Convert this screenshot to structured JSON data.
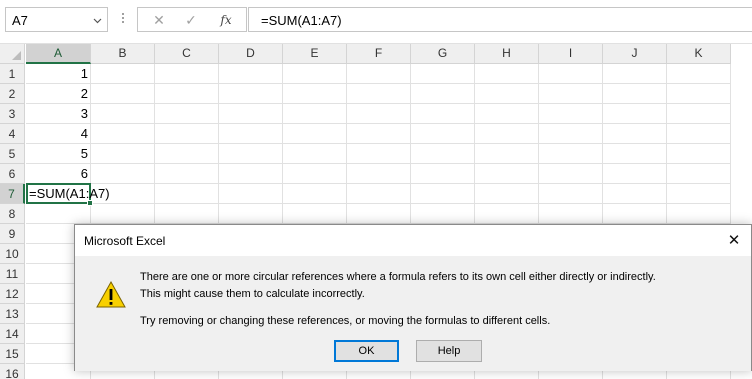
{
  "formula_bar": {
    "name_box": "A7",
    "cancel_symbol": "✕",
    "enter_symbol": "✓",
    "function_symbol": "fx",
    "formula": "=SUM(A1:A7)"
  },
  "columns": [
    "A",
    "B",
    "C",
    "D",
    "E",
    "F",
    "G",
    "H",
    "I",
    "J",
    "K"
  ],
  "rows": [
    "1",
    "2",
    "3",
    "4",
    "5",
    "6",
    "7",
    "8",
    "9",
    "10",
    "11",
    "12",
    "13",
    "14",
    "15",
    "16"
  ],
  "cells": {
    "A1": "1",
    "A2": "2",
    "A3": "3",
    "A4": "4",
    "A5": "5",
    "A6": "6",
    "A7": "=SUM(A1:A7)"
  },
  "selection": {
    "column": "A",
    "row": "7"
  },
  "colors": {
    "accent_green": "#217346",
    "focus_blue": "#0078d7",
    "warning_yellow": "#f8d000"
  },
  "dialog": {
    "title": "Microsoft Excel",
    "close_symbol": "✕",
    "icon": "warning-icon",
    "message_line_1": "There are one or more circular references where a formula refers to its own cell either directly or indirectly.",
    "message_line_2": "This might cause them to calculate incorrectly.",
    "message_line_3": "Try removing or changing these references, or moving the formulas to different cells.",
    "ok_label": "OK",
    "help_label": "Help"
  }
}
